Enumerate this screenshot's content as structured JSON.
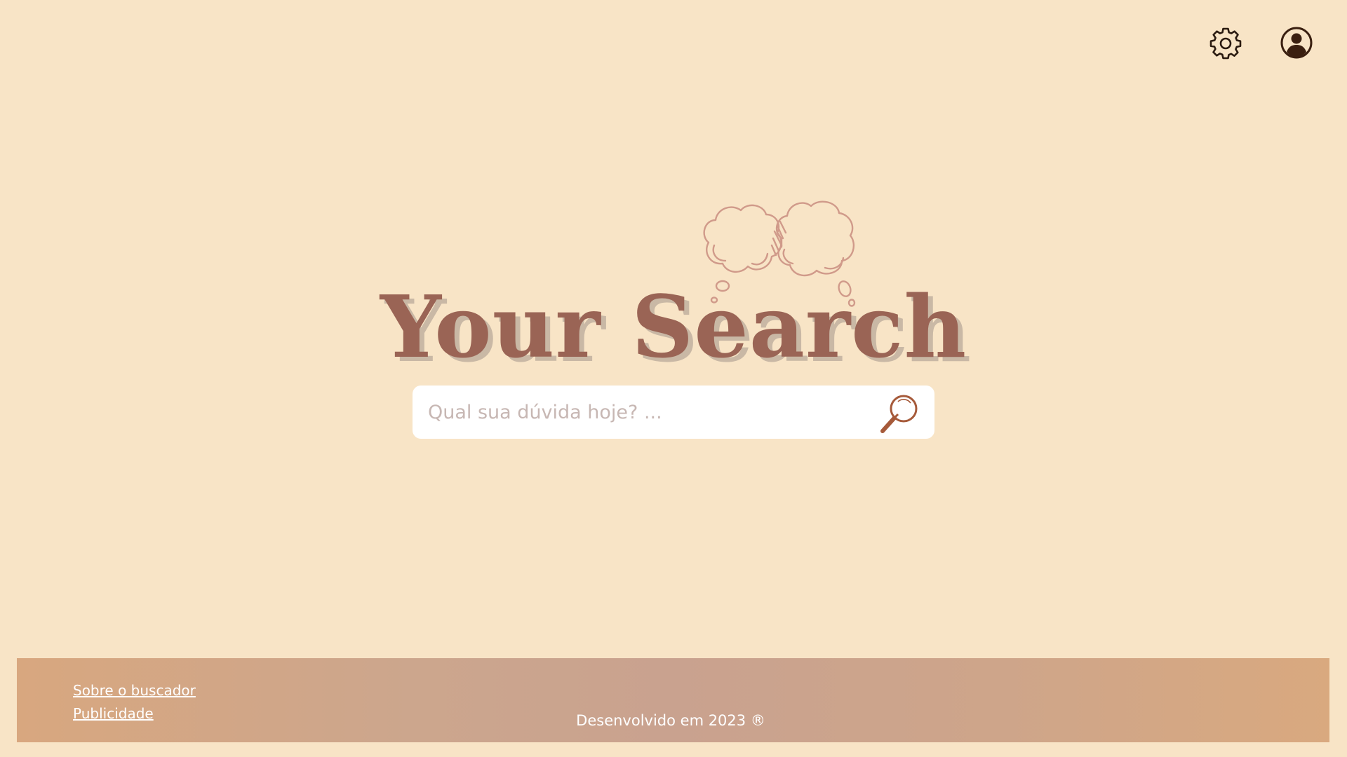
{
  "header": {
    "settings_icon": "gear-icon",
    "account_icon": "user-circle-icon"
  },
  "hero": {
    "logo_text": "Your Search",
    "decoration_icon": "thought-cloud-icon"
  },
  "search": {
    "placeholder": "Qual sua dúvida hoje? ...",
    "value": "",
    "button_icon": "magnifier-icon"
  },
  "footer": {
    "links": [
      {
        "label": "Sobre o buscador"
      },
      {
        "label": "Publicidade"
      }
    ],
    "credit": "Desenvolvido em 2023 ®"
  },
  "colors": {
    "background": "#f8e4c6",
    "logo": "#9a6455",
    "logo_shadow": "#c9b8a5",
    "cloud_outline": "#d09a8a",
    "magnifier": "#a65a3a",
    "footer_start": "#d8a77f",
    "footer_mid": "#c9a28f",
    "footer_text": "#ffffff",
    "icon_dark": "#3a1f10"
  }
}
